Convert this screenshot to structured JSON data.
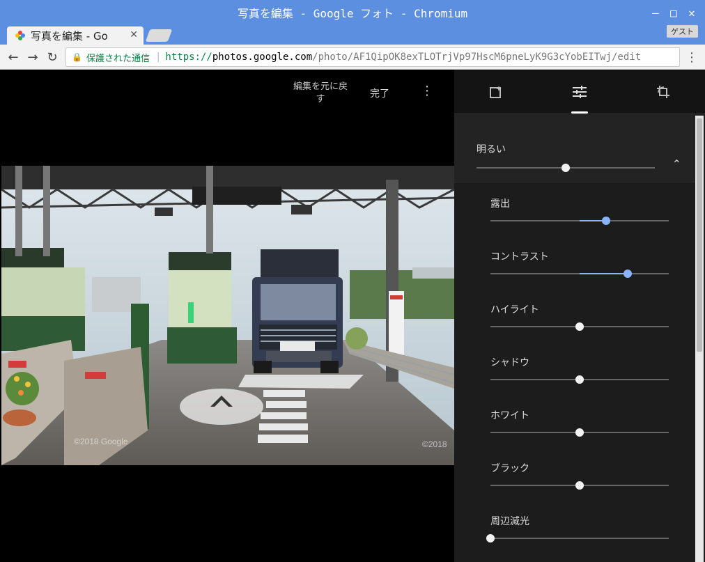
{
  "window": {
    "title": "写真を編集 - Google フォト - Chromium"
  },
  "tab": {
    "title": "写真を編集 - Go",
    "guest_label": "ゲスト"
  },
  "address": {
    "secure_label": "保護された通信",
    "scheme": "https://",
    "host": "photos.google.com",
    "path": "/photo/AF1QipOK8exTLOTrjVp97HscM6pneLyK9G3cYobEITwj/edit"
  },
  "editor": {
    "undo_label": "編集を元に戻す",
    "done_label": "完了",
    "watermark_left": "©2018 Google",
    "watermark_right": "©2018"
  },
  "panel": {
    "tabs": [
      {
        "icon": "auto-enhance-icon"
      },
      {
        "icon": "adjust-sliders-icon",
        "selected": true
      },
      {
        "icon": "crop-rotate-icon"
      }
    ],
    "section": {
      "title": "明るい",
      "value": 0.5
    },
    "adjustments": [
      {
        "label": "露出",
        "value": 0.65,
        "active": true
      },
      {
        "label": "コントラスト",
        "value": 0.77,
        "active": true
      },
      {
        "label": "ハイライト",
        "value": 0.5,
        "active": false
      },
      {
        "label": "シャドウ",
        "value": 0.5,
        "active": false
      },
      {
        "label": "ホワイト",
        "value": 0.5,
        "active": false
      },
      {
        "label": "ブラック",
        "value": 0.5,
        "active": false
      },
      {
        "label": "周辺減光",
        "value": 0.0,
        "active": false
      }
    ]
  },
  "colors": {
    "accent": "#8ab4f8",
    "titlebar": "#5c8fe0"
  }
}
